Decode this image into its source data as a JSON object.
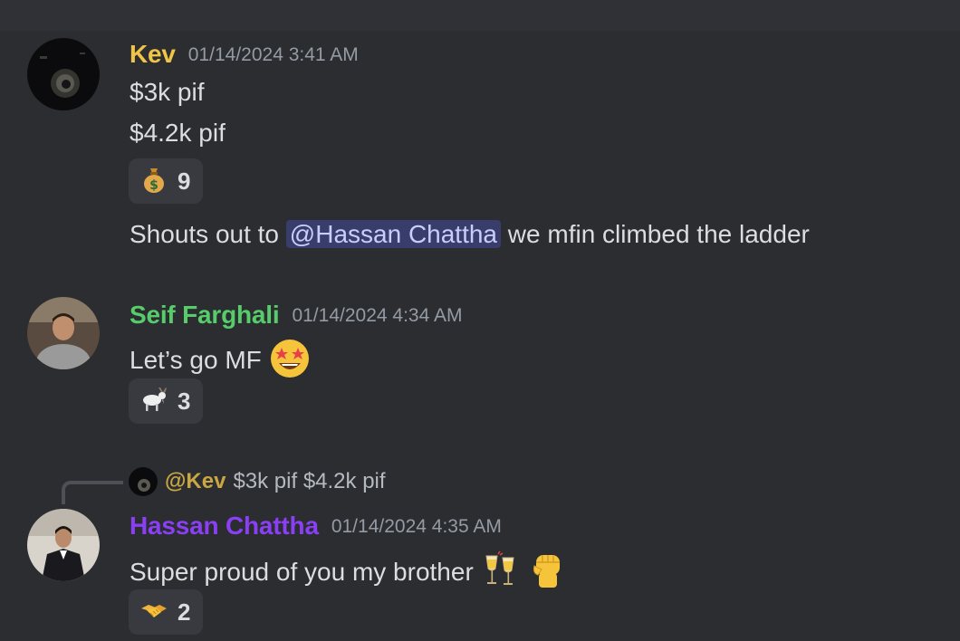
{
  "messages": [
    {
      "author": "Kev",
      "author_color": "#f0c447",
      "timestamp": "01/14/2024 3:41 AM",
      "lines": [
        "$3k pif",
        "$4.2k pif"
      ],
      "reaction": {
        "emoji": "money-bag-icon",
        "count": "9"
      },
      "followup": {
        "prefix": "Shouts out to",
        "mention": "@Hassan Chattha",
        "suffix": "we mfin climbed the ladder"
      }
    },
    {
      "author": "Seif Farghali",
      "author_color": "#57cc6a",
      "timestamp": "01/14/2024 4:34 AM",
      "text": "Let’s go MF",
      "text_emoji": "star-struck-icon",
      "reaction": {
        "emoji": "goat-icon",
        "count": "3"
      }
    },
    {
      "reply": {
        "author": "@Kev",
        "text": "$3k pif $4.2k pif"
      },
      "author": "Hassan Chattha",
      "author_color": "#8a3ff5",
      "timestamp": "01/14/2024 4:35 AM",
      "text": "Super proud of you my brother",
      "text_emojis": [
        "champagne-glasses-icon",
        "raised-fist-icon"
      ],
      "reaction": {
        "emoji": "handshake-icon",
        "count": "2"
      }
    }
  ]
}
